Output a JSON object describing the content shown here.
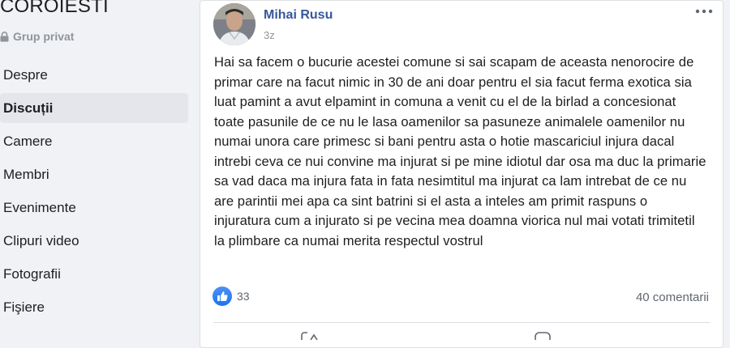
{
  "group": {
    "name": "COROIESTI",
    "privacy": "Grup privat"
  },
  "sidebar": {
    "items": [
      {
        "label": "Despre"
      },
      {
        "label": "Discuții"
      },
      {
        "label": "Camere"
      },
      {
        "label": "Membri"
      },
      {
        "label": "Evenimente"
      },
      {
        "label": "Clipuri video"
      },
      {
        "label": "Fotografii"
      },
      {
        "label": "Fişiere"
      }
    ],
    "active_index": 1
  },
  "post": {
    "author": "Mihai Rusu",
    "time": "3z",
    "text": "Hai sa facem o bucurie acestei comune si sai scapam de aceasta nenorocire de primar care na facut nimic in 30 de ani doar pentru el sia facut ferma exotica sia luat pamint a avut elpamint in comuna a venit cu el de la birlad a concesionat toate pasunile de ce nu le lasa oamenilor sa pasuneze animalele oamenilor nu numai unora care primesc si bani pentru asta o hotie mascariciul injura dacal intrebi ceva ce nui convine ma injurat si pe mine idiotul dar osa ma duc la primarie sa vad daca ma injura fata in fata nesimtitul ma injurat ca lam intrebat de ce nu are parintii mei apa ca sint batrini si el asta a inteles am primit raspuns o injuratura cum a injurato si pe vecina mea doamna viorica nul mai votati trimitetil la plimbare ca numai merita respectul vostrul",
    "reaction_count": "33",
    "comments": "40 comentarii"
  },
  "icons": {
    "privacy": "lock-icon",
    "more": "more-options-icon",
    "reaction": "like-icon",
    "share": "share-icon",
    "comment": "comment-icon"
  },
  "colors": {
    "author_link": "#365899",
    "like_blue": "#1877f2",
    "active_nav_bg": "#e4e6eb",
    "page_bg": "#f0f2f5"
  }
}
